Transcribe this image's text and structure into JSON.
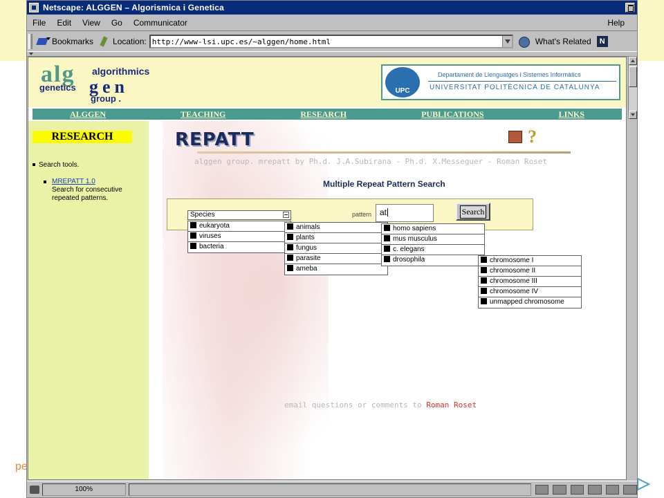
{
  "window": {
    "title": "Netscape: ALGGEN – Algorismica i Genetica"
  },
  "menu": {
    "items": [
      "File",
      "Edit",
      "View",
      "Go",
      "Communicator"
    ],
    "help": "Help"
  },
  "location_bar": {
    "bookmarks": "Bookmarks",
    "location_label": "Location:",
    "url": "http://www-lsi.upc.es/~alggen/home.html",
    "whats_related": "What's Related"
  },
  "header": {
    "logo": {
      "letters": "alg",
      "algorithmics": "algorithmics",
      "genetics": "genetics",
      "gen": "gen",
      "group": "group ."
    },
    "upc": {
      "mark": "UPC",
      "department": "Departament de Llenguatges i Sistemes Informàtics",
      "university": "UNIVERSITAT POLITÈCNICA DE CATALUNYA"
    },
    "nav": [
      "ALGGEN",
      "TEACHING",
      "RESEARCH",
      "PUBLICATIONS",
      "LINKS"
    ]
  },
  "sidebar": {
    "heading": "RESEARCH",
    "item": "Search tools.",
    "subitem_link": "MREPATT 1.0",
    "subitem_text": "Search for consecutive repeated patterns."
  },
  "main": {
    "title": "REPATT",
    "credits": "alggen group. mrepatt by Ph.d. J.A.Subirana - Ph.d. X.Messeguer - Roman Roset",
    "subtitle": "Multiple Repeat Pattern Search",
    "species_label": "Species",
    "pattern_label": "pattern",
    "pattern_value": "at",
    "search_button": "Search",
    "email_text": "email questions or comments to",
    "email_link": "Roman Roset"
  },
  "lists": {
    "species": [
      "eukaryota",
      "viruses",
      "bacteria"
    ],
    "kingdom": [
      "animals",
      "plants",
      "fungus",
      "parasite",
      "ameba"
    ],
    "organism": [
      "homo sapiens",
      "mus musculus",
      "c. elegans",
      "drosophila"
    ],
    "chromosome": [
      "chromosome I",
      "chromosome II",
      "chromosome III",
      "chromosome IV",
      "unmapped chromosome"
    ]
  },
  "status": {
    "zoom": "100%"
  },
  "slide": {
    "link_fragment": "pe"
  }
}
